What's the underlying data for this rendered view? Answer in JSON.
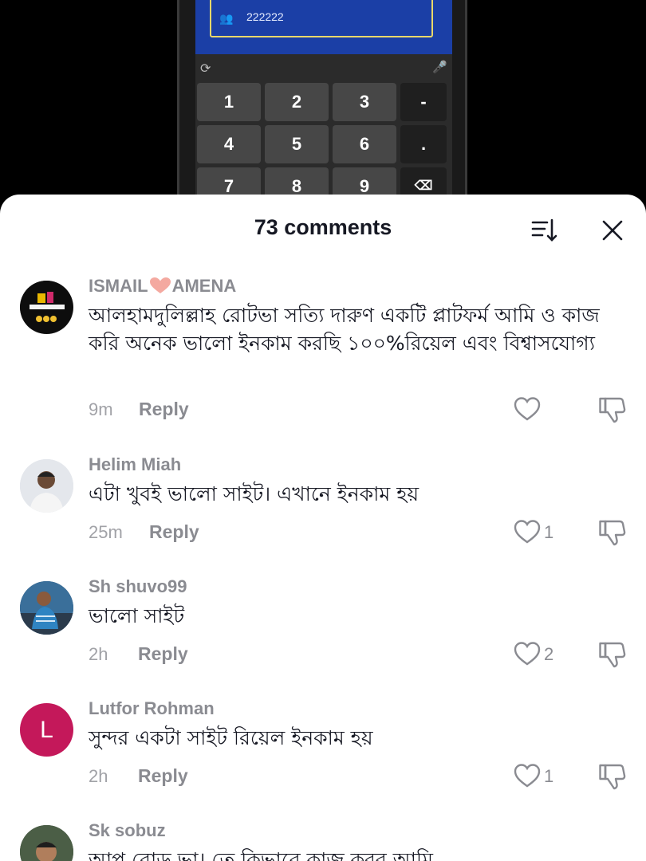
{
  "video": {
    "account_number": "222222",
    "keys": [
      "1",
      "2",
      "3",
      "-",
      "4",
      "5",
      "6",
      ".",
      "7",
      "8",
      "9"
    ]
  },
  "sheet": {
    "title": "73 comments"
  },
  "comments": [
    {
      "username": "ISMAIL",
      "username_suffix": "AMENA",
      "text": "আলহামদুলিল্লাহ রোটভা সত্যি দারুণ একটি প্লাটফর্ম আমি ও কাজ করি অনেক ভালো ইনকাম করছি ১০০%রিয়েল এবং বিশ্বাসযোগ্য",
      "time": "9m",
      "reply": "Reply",
      "likes": ""
    },
    {
      "username": "Helim Miah",
      "text": "এটা খুবই ভালো সাইট। এখানে ইনকাম হয়",
      "time": "25m",
      "reply": "Reply",
      "likes": "1"
    },
    {
      "username": "Sh shuvo99",
      "text": "ভালো সাইট",
      "time": "2h",
      "reply": "Reply",
      "likes": "2"
    },
    {
      "username": "Lutfor Rohman",
      "avatar_letter": "L",
      "text": "সুন্দর একটা সাইট রিয়েল ইনকাম হয়",
      "time": "2h",
      "reply": "Reply",
      "likes": "1"
    },
    {
      "username": "Sk sobuz",
      "text": "আপ রোড ভা। তে কিভাবে কাজ করব আমি"
    }
  ],
  "colors": {
    "accent_avatar_L": "#c4185a",
    "keyboard_blue": "#1b3fa6"
  }
}
